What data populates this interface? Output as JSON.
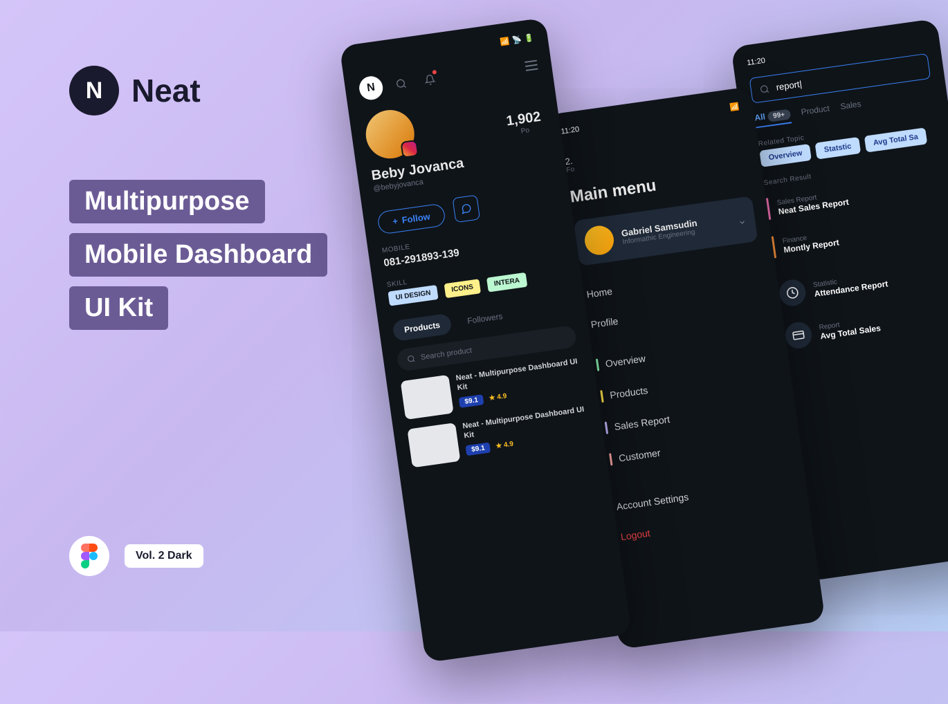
{
  "brand": {
    "logo_letter": "N",
    "name": "Neat"
  },
  "headline": {
    "l1": "Multipurpose",
    "l2": "Mobile Dashboard",
    "l3": "UI Kit"
  },
  "vol_badge": "Vol. 2 Dark",
  "screen1": {
    "logo": "N",
    "profile": {
      "name": "Beby Jovanca",
      "handle": "@bebyjovanca"
    },
    "stat": {
      "value": "1,902",
      "label": "Po"
    },
    "time_small": "11:20",
    "stat2": "2.",
    "stat2_label": "Fo",
    "follow": "Follow",
    "mobile_label": "MOBILE",
    "mobile": "081-291893-139",
    "skill_label": "SKILL",
    "skills": [
      "UI DESIGN",
      "ICONS",
      "INTERA"
    ],
    "tabs": {
      "active": "Products",
      "other": "Followers"
    },
    "search_placeholder": "Search product",
    "products": [
      {
        "title": "Neat - Multipurpose Dashboard UI Kit",
        "price": "$9.1",
        "rating": "4.9"
      },
      {
        "title": "Neat - Multipurpose Dashboard UI Kit",
        "price": "$9.1",
        "rating": "4.9"
      }
    ]
  },
  "screen2": {
    "title": "Main menu",
    "user": {
      "name": "Gabriel Samsudin",
      "sub": "Informathic Engineering"
    },
    "items": [
      "Home",
      "Profile"
    ],
    "colored": [
      "Overview",
      "Products",
      "Sales Report",
      "Customer"
    ],
    "account": "Account Settings",
    "logout": "Logout"
  },
  "screen3": {
    "time": "11:20",
    "search_value": "report|",
    "tabs": {
      "active": "All",
      "count": "99+",
      "others": [
        "Product",
        "Sales"
      ]
    },
    "related_label": "Related Topic",
    "topics": [
      "Overview",
      "Statstic",
      "Avg Total Sa"
    ],
    "search_result_label": "Search Result",
    "results_bar": [
      {
        "cat": "Sales Report",
        "title": "Neat Sales Report"
      },
      {
        "cat": "Finance",
        "title": "Montly Report"
      }
    ],
    "results_icon": [
      {
        "cat": "Statistic",
        "title": "Attendance Report"
      },
      {
        "cat": "Report",
        "title": "Avg Total Sales"
      }
    ]
  }
}
